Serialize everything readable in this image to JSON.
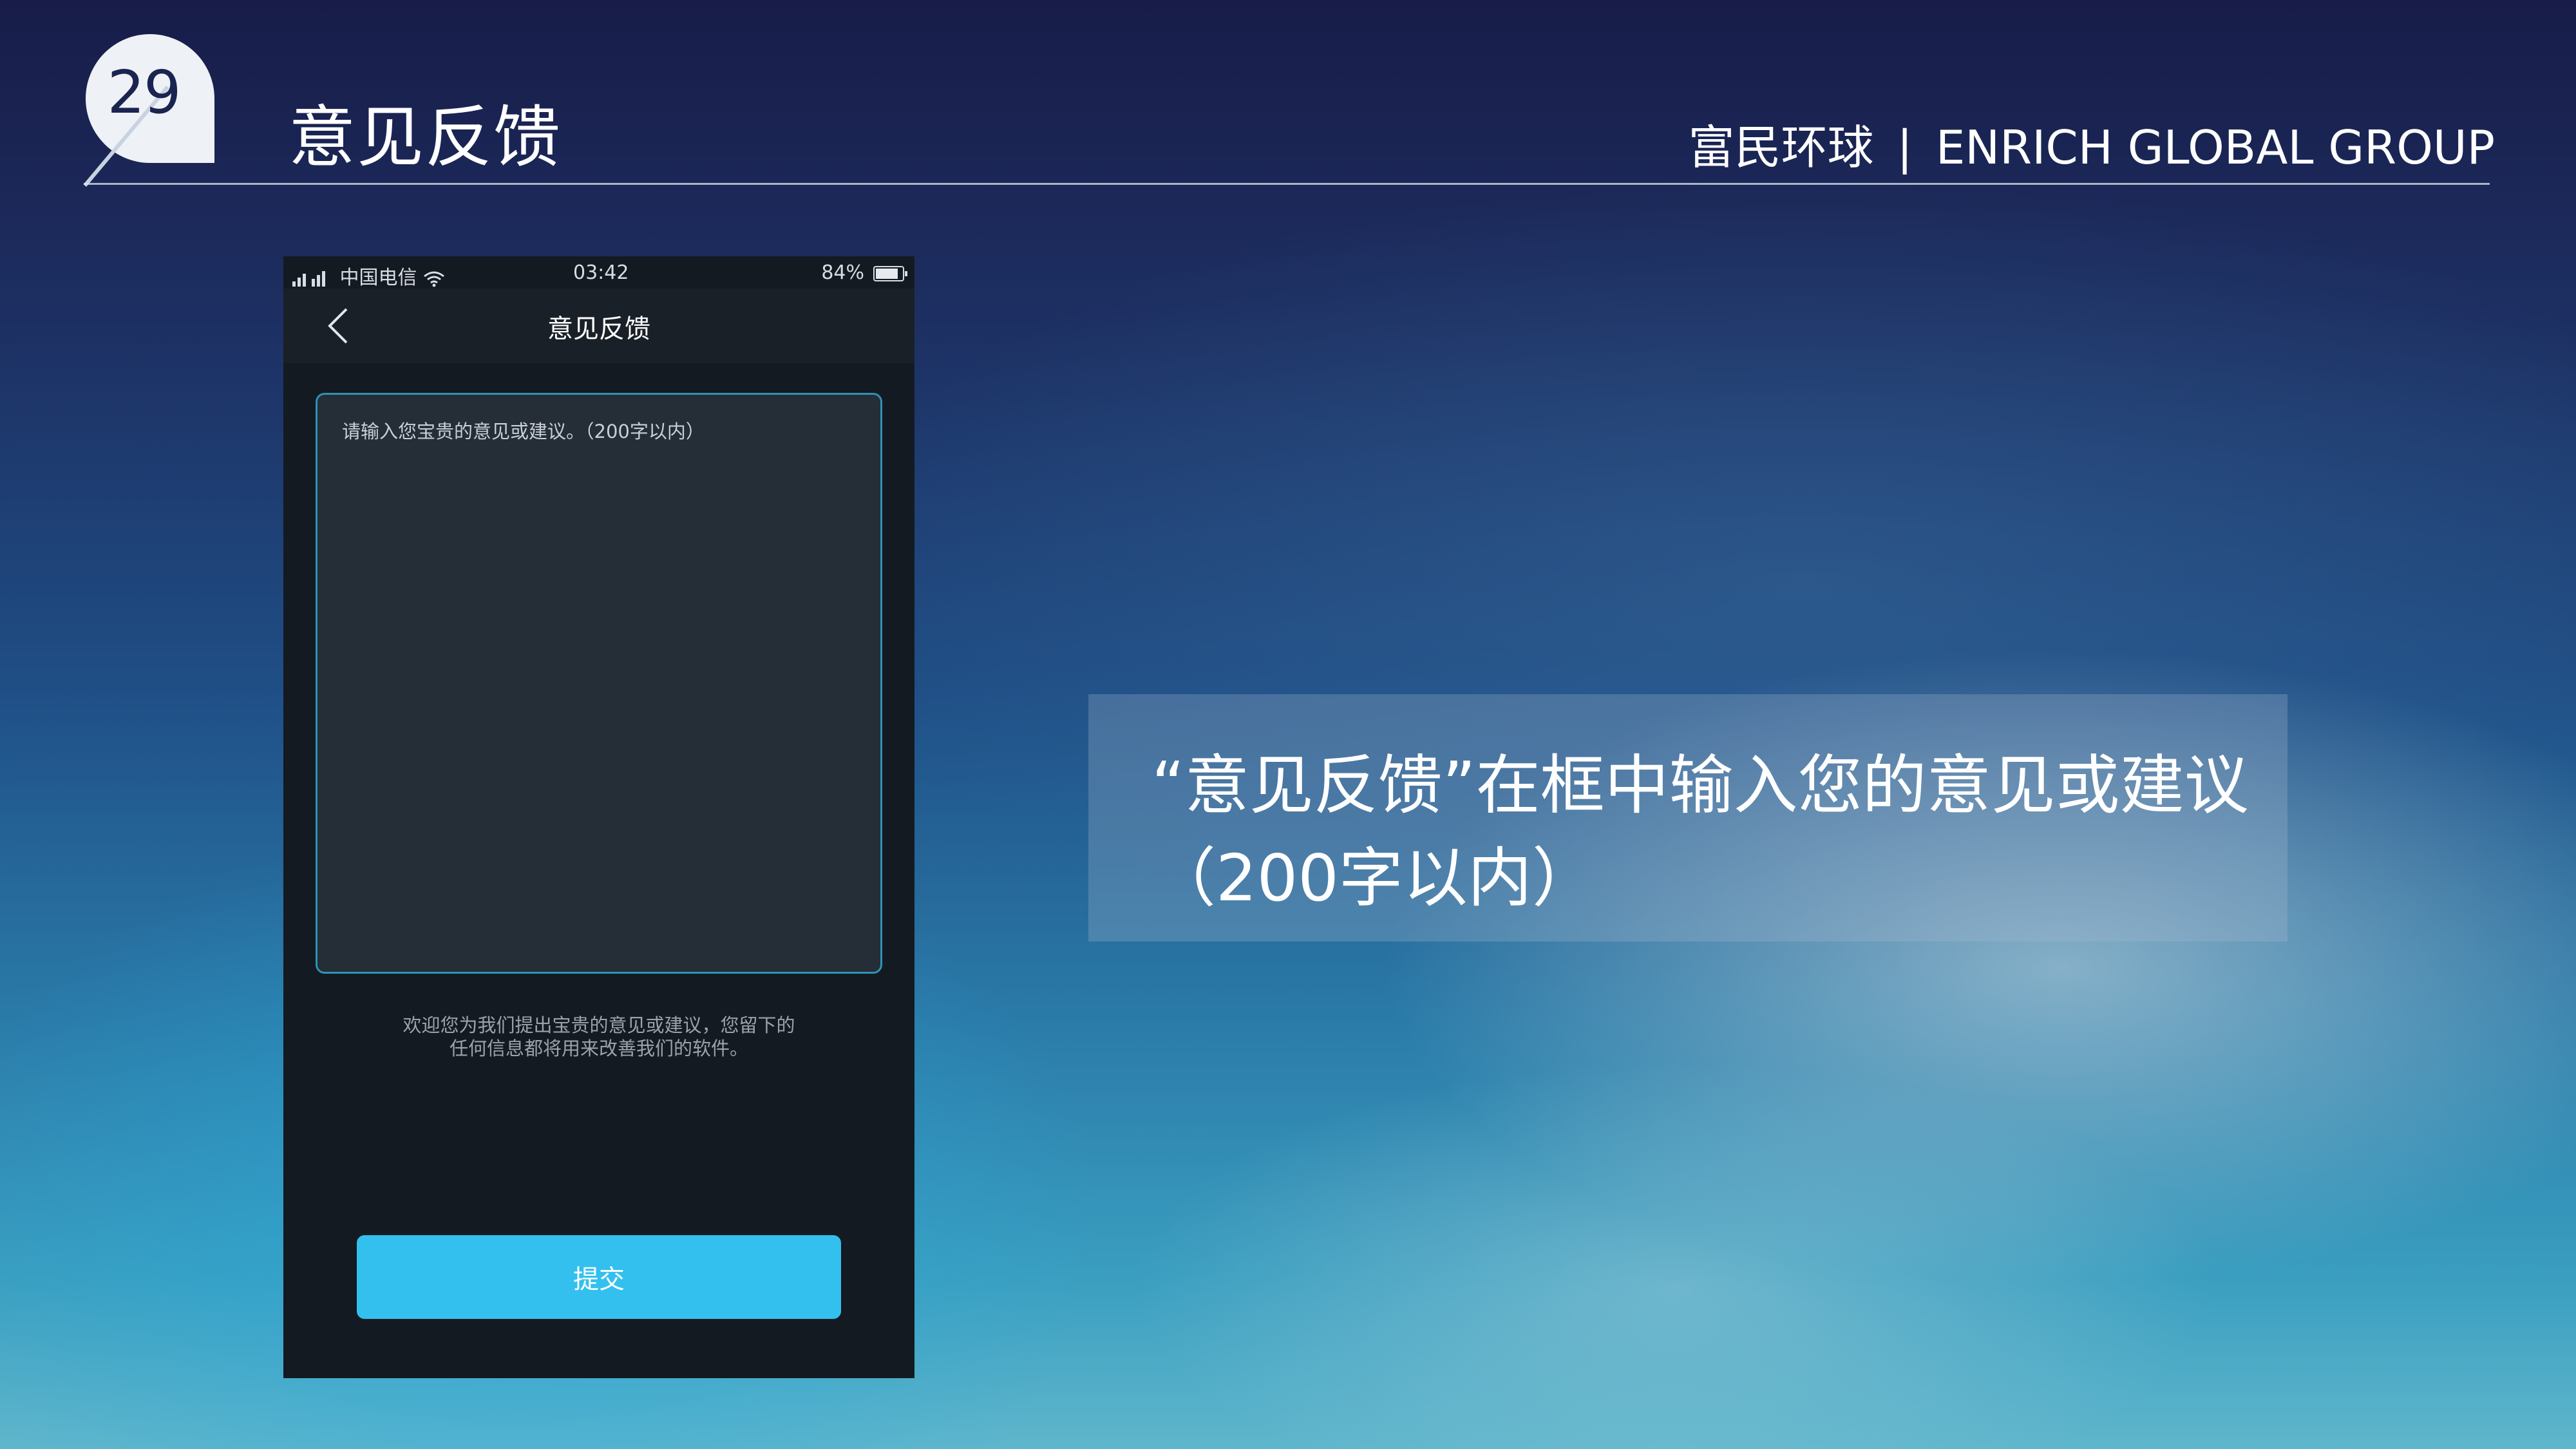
{
  "header": {
    "slide_number": "29",
    "title": "意见反馈",
    "brand_cn": "富民环球",
    "brand_sep": "|",
    "brand_en": "ENRICH GLOBAL GROUP"
  },
  "phone": {
    "status": {
      "carrier": "中国电信",
      "time": "03:42",
      "battery": "84%"
    },
    "nav_title": "意见反馈",
    "input_placeholder": "请输入您宝贵的意见或建议。（200字以内）",
    "hint_line1": "欢迎您为我们提出宝贵的意见或建议，您留下的",
    "hint_line2": "任何信息都将用来改善我们的软件。",
    "submit_label": "提交"
  },
  "caption": {
    "line1": "“意见反馈”在框中输入您的意见或建议",
    "line2": "（200字以内）"
  },
  "colors": {
    "accent": "#33c0ee",
    "input_border": "#2c93b6"
  },
  "icons": [
    "signal-icon",
    "wifi-icon",
    "battery-icon",
    "back-arrow-icon"
  ]
}
